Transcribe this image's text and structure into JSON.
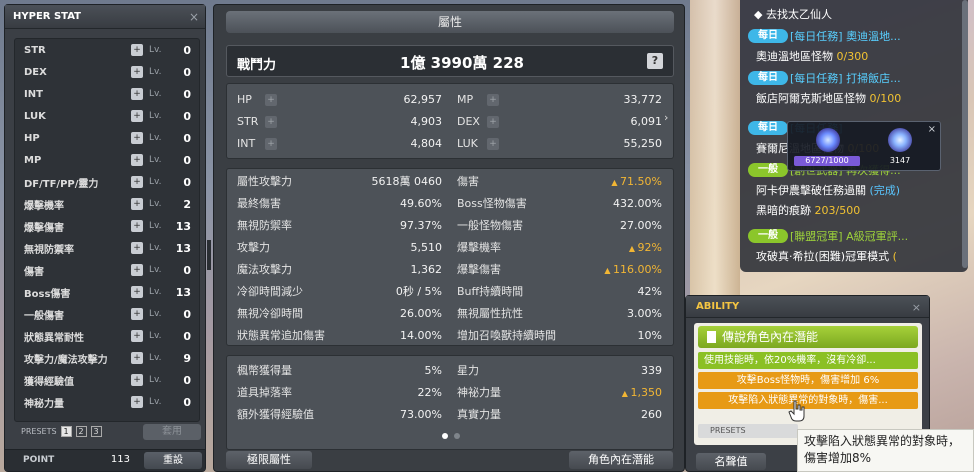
{
  "hyper_stat": {
    "title": "HYPER STAT",
    "close": "×",
    "lv_label": "Lv.",
    "rows": [
      {
        "name": "STR",
        "level": "0"
      },
      {
        "name": "DEX",
        "level": "0"
      },
      {
        "name": "INT",
        "level": "0"
      },
      {
        "name": "LUK",
        "level": "0"
      },
      {
        "name": "HP",
        "level": "0"
      },
      {
        "name": "MP",
        "level": "0"
      },
      {
        "name": "DF/TF/PP/靈力",
        "level": "0"
      },
      {
        "name": "爆擊機率",
        "level": "2"
      },
      {
        "name": "爆擊傷害",
        "level": "13"
      },
      {
        "name": "無視防禦率",
        "level": "13"
      },
      {
        "name": "傷害",
        "level": "0"
      },
      {
        "name": "Boss傷害",
        "level": "13"
      },
      {
        "name": "一般傷害",
        "level": "0"
      },
      {
        "name": "狀態異常耐性",
        "level": "0"
      },
      {
        "name": "攻擊力/魔法攻擊力",
        "level": "9"
      },
      {
        "name": "獲得經驗值",
        "level": "0"
      },
      {
        "name": "神秘力量",
        "level": "0"
      }
    ],
    "presets_label": "PRESETS",
    "presets": [
      "1",
      "2",
      "3"
    ],
    "active_preset": 0,
    "apply_label": "套用",
    "point_label": "POINT",
    "point_value": "113",
    "reset_label": "重設"
  },
  "stats": {
    "title": "屬性",
    "power_label": "戰鬥力",
    "power_value": "1億 3990萬 228",
    "help": "?",
    "basic": [
      {
        "k": "HP",
        "v": "62,957"
      },
      {
        "k": "MP",
        "v": "33,772"
      },
      {
        "k": "STR",
        "v": "4,903"
      },
      {
        "k": "DEX",
        "v": "6,091"
      },
      {
        "k": "INT",
        "v": "4,804"
      },
      {
        "k": "LUK",
        "v": "55,250"
      }
    ],
    "detail": [
      {
        "k": "屬性攻擊力",
        "v": "5618萬 0460",
        "up": false
      },
      {
        "k": "傷害",
        "v": "71.50%",
        "up": true
      },
      {
        "k": "最終傷害",
        "v": "49.60%",
        "up": false
      },
      {
        "k": "Boss怪物傷害",
        "v": "432.00%",
        "up": false
      },
      {
        "k": "無視防禦率",
        "v": "97.37%",
        "up": false
      },
      {
        "k": "一般怪物傷害",
        "v": "27.00%",
        "up": false
      },
      {
        "k": "攻擊力",
        "v": "5,510",
        "up": false
      },
      {
        "k": "爆擊機率",
        "v": "92%",
        "up": true
      },
      {
        "k": "魔法攻擊力",
        "v": "1,362",
        "up": false
      },
      {
        "k": "爆擊傷害",
        "v": "116.00%",
        "up": true
      },
      {
        "k": "冷卻時間減少",
        "v": "0秒 / 5%",
        "up": false
      },
      {
        "k": "Buff持續時間",
        "v": "42%",
        "up": false
      },
      {
        "k": "無視冷卻時間",
        "v": "26.00%",
        "up": false
      },
      {
        "k": "無視屬性抗性",
        "v": "3.00%",
        "up": false
      },
      {
        "k": "狀態異常追加傷害",
        "v": "14.00%",
        "up": false
      },
      {
        "k": "增加召喚獸持續時間",
        "v": "10%",
        "up": false
      }
    ],
    "extra": [
      {
        "k": "楓幣獲得量",
        "v": "5%",
        "up": false
      },
      {
        "k": "星力",
        "v": "339",
        "up": false
      },
      {
        "k": "道具掉落率",
        "v": "22%",
        "up": false
      },
      {
        "k": "神祕力量",
        "v": "1,350",
        "up": true
      },
      {
        "k": "額外獲得經驗值",
        "v": "73.00%",
        "up": false
      },
      {
        "k": "真實力量",
        "v": "260",
        "up": false
      }
    ],
    "expand_arrow": "›",
    "footer_left": "極限屬性",
    "footer_right": "角色內在潛能"
  },
  "quests": {
    "top": "◆ 去找太乙仙人",
    "items": [
      {
        "badge": "每日",
        "type": "daily",
        "title": "[每日任務] 奧迪溫地...",
        "sub": "奧迪溫地區怪物",
        "progress": "0/300",
        "done": ""
      },
      {
        "badge": "每日",
        "type": "daily",
        "title": "[每日任務] 打掃飯店...",
        "sub": "飯店阿爾克斯地區怪物",
        "progress": "0/100",
        "done": ""
      },
      {
        "badge": "每日",
        "type": "daily",
        "title": "[每日任務]",
        "sub": "賽爾尼溫地區怪物",
        "progress": "0/100",
        "done": ""
      },
      {
        "badge": "一般",
        "type": "normal",
        "title": "[創世武器] 再次獲得...",
        "sub": "阿卡伊農擊破任務過關",
        "progress": "",
        "done": "(完成)"
      },
      {
        "badge": "",
        "type": "normal",
        "title": "",
        "sub": "黑暗的痕跡",
        "progress": "203/500",
        "done": ""
      },
      {
        "badge": "一般",
        "type": "normal",
        "title": "[聯盟冠軍] A級冠軍評...",
        "sub": "攻破真·希拉(困難)冠軍模式",
        "progress": "(",
        "done": ""
      }
    ]
  },
  "buff": {
    "close": "×",
    "value1": "6727/1000",
    "value1_fraction": 1.0,
    "value2": "3147"
  },
  "ability": {
    "title": "ABILITY",
    "close": "×",
    "header": "傳說角色內在潛能",
    "lines": [
      {
        "text": "使用技能時，依20%機率，沒有冷卻...",
        "color": "green"
      },
      {
        "text": "攻擊Boss怪物時，傷害增加 6%",
        "color": "orange"
      },
      {
        "text": "攻擊陷入狀態異常的對象時，傷害...",
        "color": "orange"
      }
    ],
    "presets_label": "PRESETS",
    "footer": "名聲值"
  },
  "tooltip": {
    "text": "攻擊陷入狀態異常的對象時，傷害增加8%"
  }
}
